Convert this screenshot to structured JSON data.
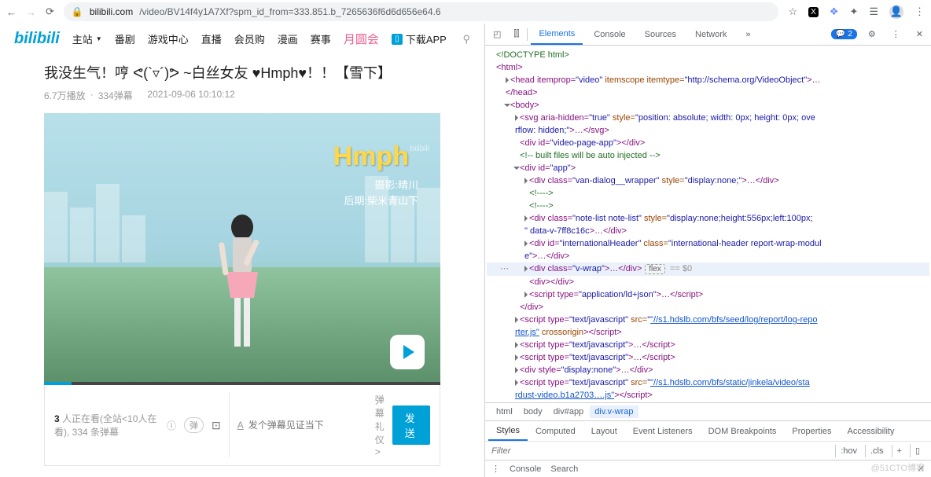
{
  "browser": {
    "url_host": "bilibili.com",
    "url_path": "/video/BV14f4y1A7Xf?spm_id_from=333.851.b_7265636f6d6d656e64.6"
  },
  "nav": {
    "logo": "bilibili",
    "items": [
      "主站",
      "番剧",
      "游戏中心",
      "直播",
      "会员购",
      "漫画",
      "赛事"
    ],
    "special": "月圆会",
    "download": "下载APP"
  },
  "video": {
    "title": "我没生气！哼 ᕙ(`▿´)ᕗ ~白丝女友 ♥Hmph♥！！【雪下】",
    "plays": "6.7万播放",
    "danmu_count": "334弹幕",
    "date": "2021-09-06 10:10:12",
    "overlay": "Hmph",
    "watermark": "bilibili",
    "credit1": "摄影:晴川",
    "credit2": "后期:柴米青山下",
    "viewers_num": "3",
    "viewers_text": "人正在看(全站<10人在看), 334 条弹幕",
    "danmu_toggle": "弹",
    "font_ic": "A",
    "danmu_placeholder": "发个弹幕见证当下",
    "gift": "弹幕礼仪",
    "send": "发送"
  },
  "devtools": {
    "tabs": [
      "Elements",
      "Console",
      "Sources",
      "Network"
    ],
    "badge": "2",
    "crumbs": [
      "html",
      "body",
      "div#app",
      "div.v-wrap"
    ],
    "style_tabs": [
      "Styles",
      "Computed",
      "Layout",
      "Event Listeners",
      "DOM Breakpoints",
      "Properties",
      "Accessibility"
    ],
    "filter_placeholder": "Filter",
    "hov": ":hov",
    "cls": ".cls",
    "drawer": [
      "Console",
      "Search"
    ],
    "dom": {
      "l1": "<!DOCTYPE html>",
      "l2": "<html>",
      "l3a": "<head itemprop=",
      "l3b": "\"video\"",
      "l3c": " itemscope itemtype=",
      "l3d": "\"http://schema.org/VideoObject\"",
      "l3e": ">…",
      "l4": "</head>",
      "l5": "<body>",
      "l6a": "<svg aria-hidden=",
      "l6b": "\"true\"",
      "l6c": " style=",
      "l6d": "\"position: absolute; width: 0px; height: 0px; ove",
      "l6e": "rflow: hidden;\"",
      "l6f": ">…</svg>",
      "l7a": "<div id=",
      "l7b": "\"video-page-app\"",
      "l7c": "></div>",
      "l8": "<!-- built files will be auto injected -->",
      "l9a": "<div id=",
      "l9b": "\"app\"",
      "l9c": ">",
      "l10a": "<div class=",
      "l10b": "\"van-dialog__wrapper\"",
      "l10c": " style=",
      "l10d": "\"display:none;\"",
      "l10e": ">…</div>",
      "l11": "<!---->",
      "l12": "<!---->",
      "l13a": "<div class=",
      "l13b": "\"note-list note-list\"",
      "l13c": " style=",
      "l13d": "\"display:none;height:556px;left:100px;",
      "l13e": "\" data-v-7ff8c16c",
      "l13f": ">…</div>",
      "l14a": "<div id=",
      "l14b": "\"internationalHeader\"",
      "l14c": " class=",
      "l14d": "\"international-header report-wrap-modul",
      "l14e": "e\"",
      "l14f": ">…</div>",
      "l15a": "<div class=",
      "l15b": "\"v-wrap\"",
      "l15c": ">…</div>",
      "l15flex": "flex",
      "l15eq": "== $0",
      "l16": "<div></div>",
      "l17a": "<script type=",
      "l17b": "\"application/ld+json\"",
      "l17c": ">…</scr",
      "l17d": "ipt>",
      "l18": "</div>",
      "l19a": "<script type=",
      "l19b": "\"text/javascript\"",
      "l19c": " src=",
      "l19d": "\"//s1.hdslb.com/bfs/seed/log/report/log-repo",
      "l19e": "rter.js\"",
      "l19f": " crossorigin",
      "l19g": "></scr",
      "l19h": "ipt>",
      "l20a": "<script type=",
      "l20b": "\"text/javascript\"",
      "l20c": ">…</scr",
      "l20d": "ipt>",
      "l22a": "<div style=",
      "l22b": "\"display:none\"",
      "l22c": ">…</div>",
      "l23a": "<script type=",
      "l23b": "\"text/javascript\"",
      "l23c": " src=",
      "l23d": "\"//s1.hdslb.com/bfs/static/jinkela/video/sta",
      "l23e": "rdust-video.b1a2703….js\"",
      "l23f": "></scr",
      "l23g": "ipt>"
    }
  },
  "footer": "@51CTO博客"
}
